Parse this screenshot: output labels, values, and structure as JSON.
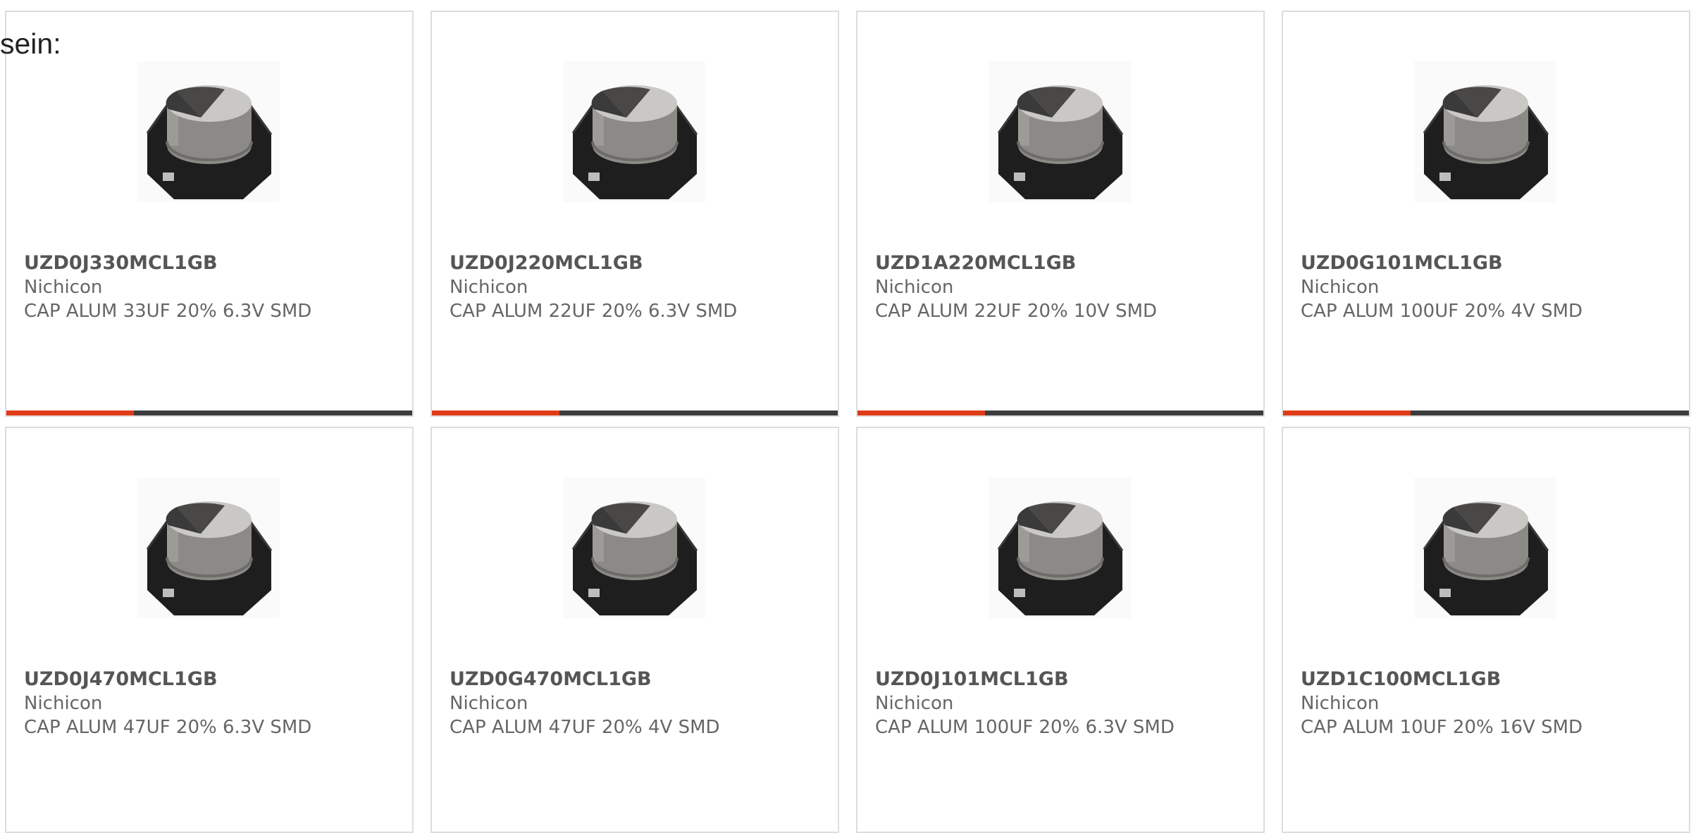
{
  "lead_text": "sein:",
  "colors": {
    "accent": "#e03b16",
    "bar": "#3c3c3c",
    "border": "#dddddd",
    "title": "#555555",
    "text": "#666666"
  },
  "product_image": {
    "icon": "smd-capacitor-image"
  },
  "products": [
    {
      "part_number": "UZD0J330MCL1GB",
      "manufacturer": "Nichicon",
      "description": "CAP ALUM 33UF 20% 6.3V SMD"
    },
    {
      "part_number": "UZD0J220MCL1GB",
      "manufacturer": "Nichicon",
      "description": "CAP ALUM 22UF 20% 6.3V SMD"
    },
    {
      "part_number": "UZD1A220MCL1GB",
      "manufacturer": "Nichicon",
      "description": "CAP ALUM 22UF 20% 10V SMD"
    },
    {
      "part_number": "UZD0G101MCL1GB",
      "manufacturer": "Nichicon",
      "description": "CAP ALUM 100UF 20% 4V SMD"
    },
    {
      "part_number": "UZD0J470MCL1GB",
      "manufacturer": "Nichicon",
      "description": "CAP ALUM 47UF 20% 6.3V SMD"
    },
    {
      "part_number": "UZD0G470MCL1GB",
      "manufacturer": "Nichicon",
      "description": "CAP ALUM 47UF 20% 4V SMD"
    },
    {
      "part_number": "UZD0J101MCL1GB",
      "manufacturer": "Nichicon",
      "description": "CAP ALUM 100UF 20% 6.3V SMD"
    },
    {
      "part_number": "UZD1C100MCL1GB",
      "manufacturer": "Nichicon",
      "description": "CAP ALUM 10UF 20% 16V SMD"
    }
  ]
}
